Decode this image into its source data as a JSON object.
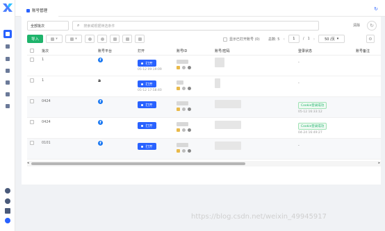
{
  "tab": {
    "title": "账号管理"
  },
  "filter": {
    "value": "全部批次"
  },
  "search": {
    "placeholder": "搜索或根据筛选条件"
  },
  "clear_label": "清除",
  "toolbar": {
    "import_label": "导入"
  },
  "show_opened": {
    "label": "显示已打开账号 (0)"
  },
  "pager": {
    "total_label": "总数: 5",
    "current_page": "1",
    "of": "/",
    "total_pages": "1",
    "page_size": "50 /页"
  },
  "table": {
    "headers": [
      "批次",
      "账号平台",
      "打开",
      "账号ID",
      "账号/密码",
      "登录状态",
      "账号备注"
    ],
    "rows": [
      {
        "batch": "1",
        "platform": "facebook",
        "open_label": "打开",
        "open_time": "05-12 09:19:09",
        "status": "-",
        "status_time": ""
      },
      {
        "batch": "1",
        "platform": "amazon",
        "open_label": "打开",
        "open_time": "05-12 17:58:40",
        "status": "-",
        "status_time": ""
      },
      {
        "batch": "0424",
        "platform": "facebook",
        "open_label": "打开",
        "open_time": "",
        "status": "Cookie登录成功",
        "status_time": "05-12 16:33:12"
      },
      {
        "batch": "0424",
        "platform": "facebook",
        "open_label": "打开",
        "open_time": "",
        "status": "Cookie登录成功",
        "status_time": "04-24 16:49:27"
      },
      {
        "batch": "0101",
        "platform": "facebook",
        "open_label": "打开",
        "open_time": "",
        "status": "-",
        "status_time": ""
      }
    ]
  },
  "amazon_glyph": "a",
  "facebook_glyph": "f",
  "watermark": "https://blog.csdn.net/weixin_49945917",
  "colors": {
    "primary": "#2962ff",
    "success": "#1eb36b",
    "import": "#1eb36b"
  }
}
